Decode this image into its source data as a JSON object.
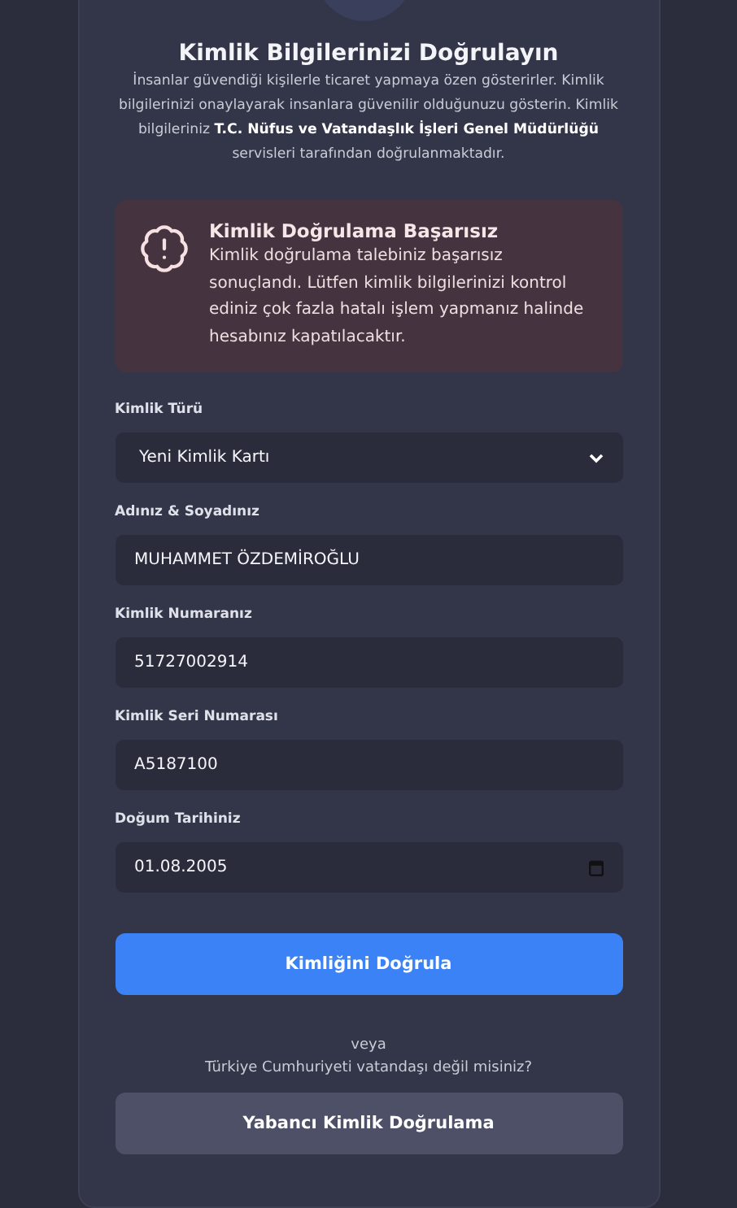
{
  "header": {
    "title": "Kimlik Bilgilerinizi Doğrulayın",
    "description": "İnsanlar güvendiği kişilerle ticaret yapmaya özen gösterirler. Kimlik bilgilerinizi onaylayarak insanlara güvenilir olduğunuzu gösterin. Kimlik bilgileriniz **T.C. Nüfus ve Vatandaşlık İşleri Genel Müdürlüğü** servisleri tarafından doğrulanmaktadır."
  },
  "alert": {
    "kind": "error",
    "title": "Kimlik Doğrulama Başarısız",
    "message": "Kimlik doğrulama talebiniz başarısız sonuçlandı. Lütfen kimlik bilgilerinizi kontrol ediniz çok fazla hatalı işlem yapmanız halinde hesabınız kapatılacaktır."
  },
  "fields": [
    {
      "kind": "select",
      "label": "Kimlik Türü",
      "value": "Yeni Kimlik Kartı"
    },
    {
      "kind": "text",
      "label": "Adınız & Soyadınız",
      "value": "MUHAMMET ÖZDEMİROĞLU"
    },
    {
      "kind": "text",
      "label": "Kimlik Numaranız",
      "value": "51727002914"
    },
    {
      "kind": "text",
      "label": "Kimlik Seri Numarası",
      "value": "A5187100"
    },
    {
      "kind": "date",
      "label": "Doğum Tarihiniz",
      "value": "01.08.2005"
    }
  ],
  "submit_button": "Kimliğini Doğrula",
  "separator": "veya",
  "question": "Türkiye Cumhuriyeti vatandaşı değil misiniz?",
  "foreign_button": "Yabancı Kimlik Doğrulama"
}
